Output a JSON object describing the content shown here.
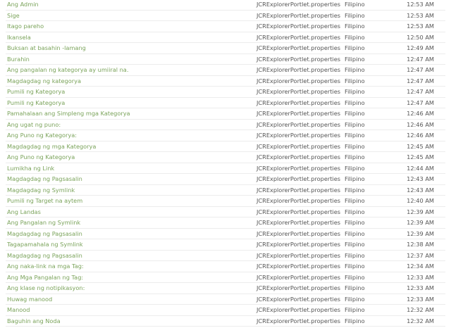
{
  "rows": [
    [
      "Ang Admin",
      "JCRExplorerPortlet.properties",
      "Filipino",
      "12:53 AM"
    ],
    [
      "Sige",
      "JCRExplorerPortlet.properties",
      "Filipino",
      "12:53 AM"
    ],
    [
      "Itago pareho",
      "JCRExplorerPortlet.properties",
      "Filipino",
      "12:53 AM"
    ],
    [
      "Ikansela",
      "JCRExplorerPortlet.properties",
      "Filipino",
      "12:50 AM"
    ],
    [
      "Buksan at basahin -lamang",
      "JCRExplorerPortlet.properties",
      "Filipino",
      "12:49 AM"
    ],
    [
      "Burahin",
      "JCRExplorerPortlet.properties",
      "Filipino",
      "12:47 AM"
    ],
    [
      "Ang pangalan ng kategorya ay umiiral na.",
      "JCRExplorerPortlet.properties",
      "Filipino",
      "12:47 AM"
    ],
    [
      "Magdagdag ng kategorya",
      "JCRExplorerPortlet.properties",
      "Filipino",
      "12:47 AM"
    ],
    [
      "Pumili ng Kategorya",
      "JCRExplorerPortlet.properties",
      "Filipino",
      "12:47 AM"
    ],
    [
      "Pumili ng Kategorya",
      "JCRExplorerPortlet.properties",
      "Filipino",
      "12:47 AM"
    ],
    [
      "Pamahalaan ang Simpleng mga Kategorya",
      "JCRExplorerPortlet.properties",
      "Filipino",
      "12:46 AM"
    ],
    [
      "Ang ugat ng puno:",
      "JCRExplorerPortlet.properties",
      "Filipino",
      "12:46 AM"
    ],
    [
      "Ang Puno ng Kategorya:",
      "JCRExplorerPortlet.properties",
      "Filipino",
      "12:46 AM"
    ],
    [
      "Magdagdag ng mga Kategorya",
      "JCRExplorerPortlet.properties",
      "Filipino",
      "12:45 AM"
    ],
    [
      "Ang Puno ng Kategorya",
      "JCRExplorerPortlet.properties",
      "Filipino",
      "12:45 AM"
    ],
    [
      "Lumikha ng Link",
      "JCRExplorerPortlet.properties",
      "Filipino",
      "12:44 AM"
    ],
    [
      "Magdagdag ng Pagsasalin",
      "JCRExplorerPortlet.properties",
      "Filipino",
      "12:43 AM"
    ],
    [
      "Magdagdag ng Symlink",
      "JCRExplorerPortlet.properties",
      "Filipino",
      "12:43 AM"
    ],
    [
      "Pumili ng Target na aytem",
      "JCRExplorerPortlet.properties",
      "Filipino",
      "12:40 AM"
    ],
    [
      "Ang Landas",
      "JCRExplorerPortlet.properties",
      "Filipino",
      "12:39 AM"
    ],
    [
      "Ang Pangalan ng Symlink",
      "JCRExplorerPortlet.properties",
      "Filipino",
      "12:39 AM"
    ],
    [
      "Magdagdag ng Pagsasalin",
      "JCRExplorerPortlet.properties",
      "Filipino",
      "12:39 AM"
    ],
    [
      "Tagapamahala ng Symlink",
      "JCRExplorerPortlet.properties",
      "Filipino",
      "12:38 AM"
    ],
    [
      "Magdagdag ng Pagsasalin",
      "JCRExplorerPortlet.properties",
      "Filipino",
      "12:37 AM"
    ],
    [
      "Ang naka-link na mga Tag:",
      "JCRExplorerPortlet.properties",
      "Filipino",
      "12:34 AM"
    ],
    [
      "Ang Mga Pangalan ng Tag:",
      "JCRExplorerPortlet.properties",
      "Filipino",
      "12:33 AM"
    ],
    [
      "Ang klase ng notipikasyon:",
      "JCRExplorerPortlet.properties",
      "Filipino",
      "12:33 AM"
    ],
    [
      "Huwag manood",
      "JCRExplorerPortlet.properties",
      "Filipino",
      "12:33 AM"
    ],
    [
      "Manood",
      "JCRExplorerPortlet.properties",
      "Filipino",
      "12:32 AM"
    ],
    [
      "Baguhin ang Noda",
      "JCRExplorerPortlet.properties",
      "Filipino",
      "12:32 AM"
    ]
  ]
}
